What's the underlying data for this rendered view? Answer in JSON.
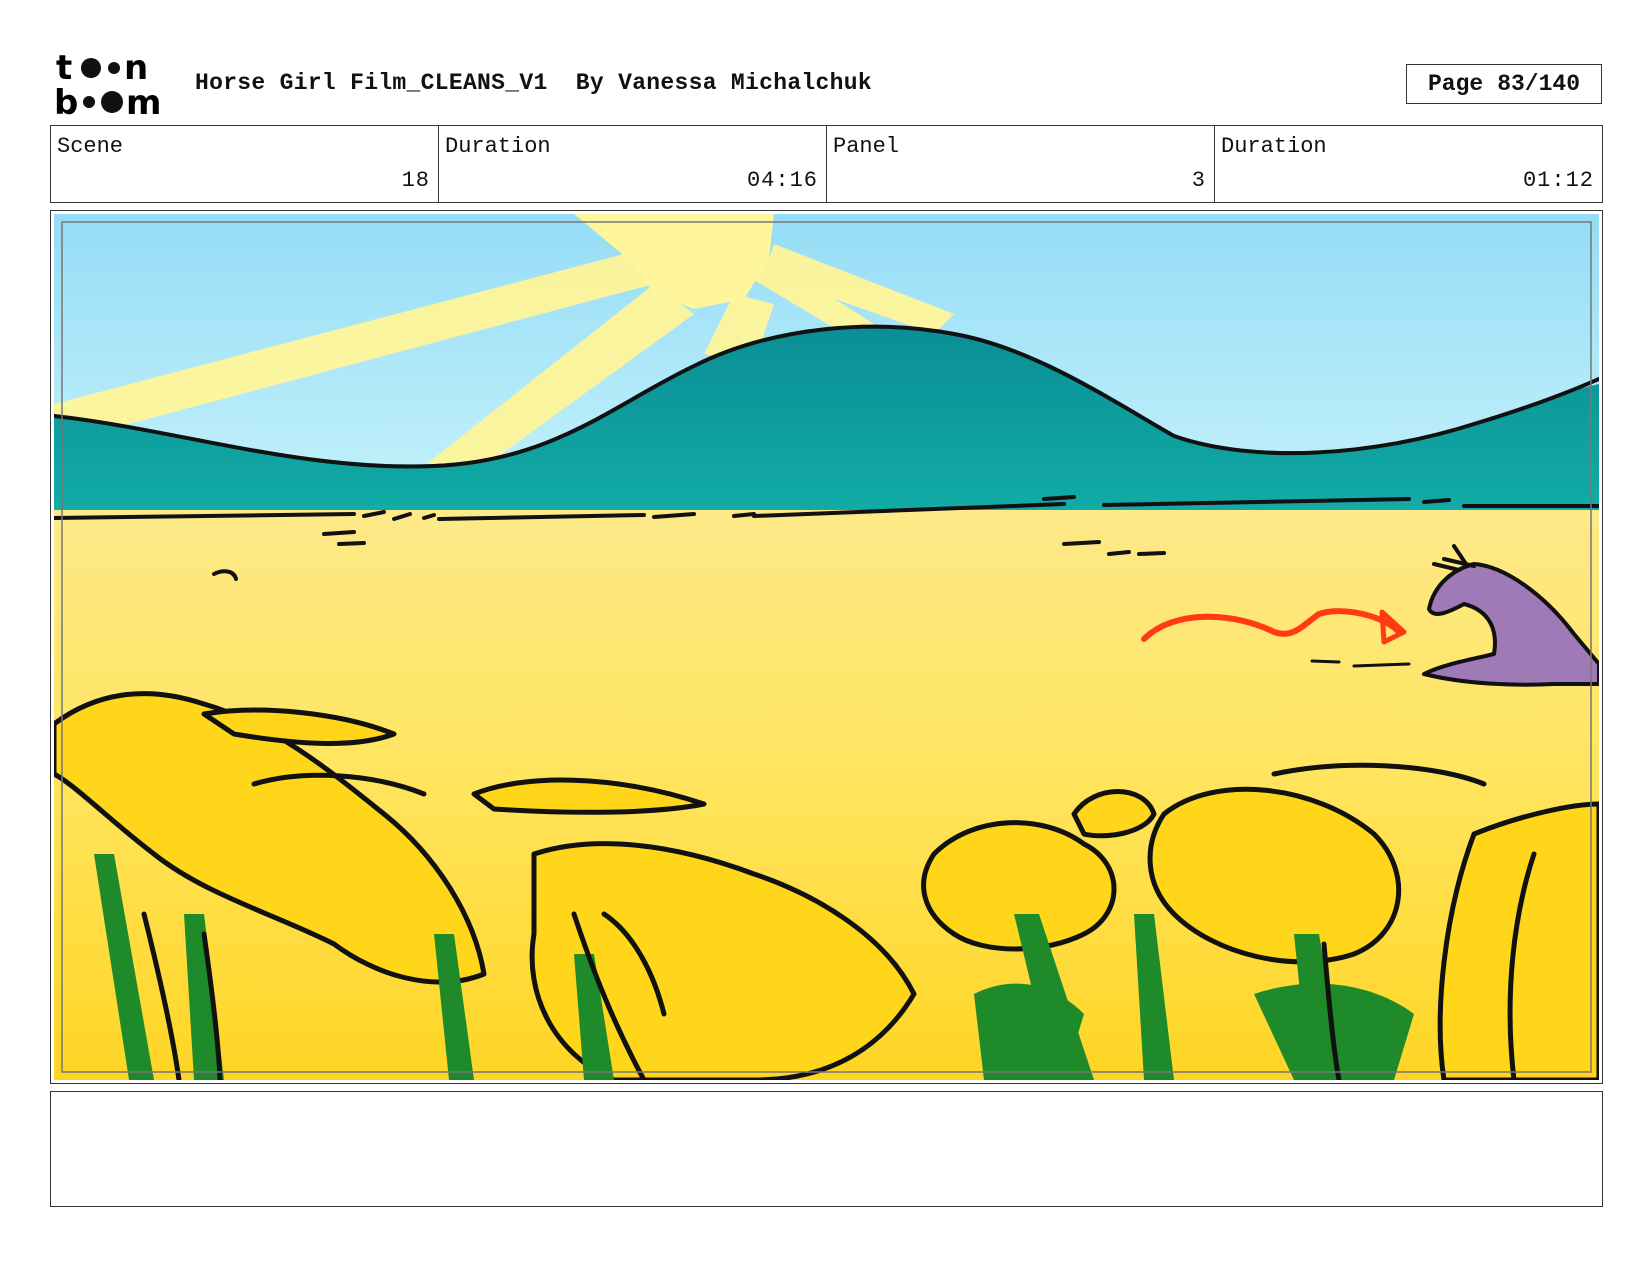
{
  "header": {
    "logo_top": "t",
    "logo_bottom_b": "b",
    "logo_bottom_m": "m",
    "logo_top_n": "n",
    "title": "Horse Girl Film_CLEANS_V1",
    "author": "By Vanessa Michalchuk",
    "page_label": "Page",
    "page_value": "83/140"
  },
  "info": {
    "scene_label": "Scene",
    "scene_value": "18",
    "scene_duration_label": "Duration",
    "scene_duration_value": "04:16",
    "panel_label": "Panel",
    "panel_value": "3",
    "panel_duration_label": "Duration",
    "panel_duration_value": "01:12"
  },
  "colors": {
    "sky": "#aee9fb",
    "sun": "#fff59a",
    "hill": "#0f9a9c",
    "field": "#ffe56a",
    "flowers": "#ffd61a",
    "stems": "#1f8a2a",
    "horse": "#a07ab6",
    "arrow": "#ff3a14"
  },
  "notes": {
    "text": ""
  }
}
